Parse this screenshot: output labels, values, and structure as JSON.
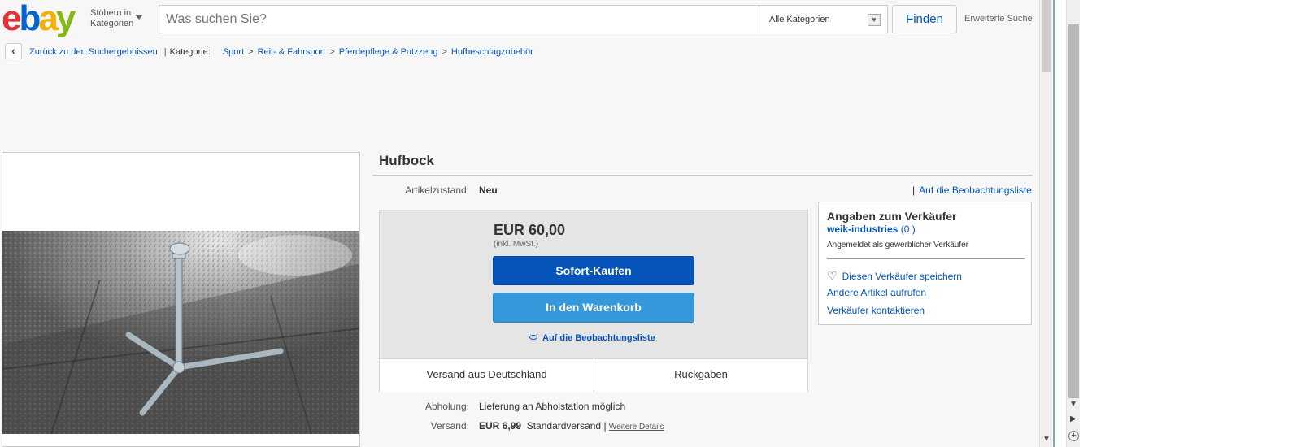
{
  "header": {
    "logo": {
      "e": "e",
      "b": "b",
      "a": "a",
      "y": "y"
    },
    "browse_line1": "Stöbern in",
    "browse_line2": "Kategorien",
    "search_placeholder": "Was suchen Sie?",
    "category_select": "Alle Kategorien",
    "find_label": "Finden",
    "advanced_label": "Erweiterte Suche"
  },
  "breadcrumb": {
    "back_label": "Zurück zu den Suchergebnissen",
    "category_prefix": "Kategorie:",
    "items": [
      "Sport",
      "Reit- & Fahrsport",
      "Pferdepflege & Putzzeug",
      "Hufbeschlagzubehör"
    ],
    "separator": ">"
  },
  "item": {
    "title": "Hufbock",
    "condition_label": "Artikelzustand:",
    "condition_value": "Neu",
    "watch_top": "Auf die Beobachtungsliste",
    "price": "EUR 60,00",
    "vat_note": "(inkl. MwSt.)",
    "buy_now": "Sofort-Kaufen",
    "add_to_cart": "In den Warenkorb",
    "watch_link": "Auf die Beobachtungsliste",
    "tab_shipping": "Versand aus Deutschland",
    "tab_returns": "Rückgaben",
    "pickup_label": "Abholung:",
    "pickup_value": "Lieferung an Abholstation möglich",
    "shipping_label": "Versand:",
    "shipping_price": "EUR 6,99",
    "shipping_method": "Standardversand",
    "shipping_more": "Weitere Details"
  },
  "seller": {
    "heading": "Angaben zum Verkäufer",
    "name": "weik-industries",
    "rating": "(0 )",
    "type": "Angemeldet als gewerblicher Verkäufer",
    "save": "Diesen Verkäufer speichern",
    "other_items": "Andere Artikel aufrufen",
    "contact": "Verkäufer kontaktieren"
  },
  "colors": {
    "ebay_red": "#e53238",
    "ebay_blue": "#0064d2",
    "ebay_yellow": "#f5af02",
    "ebay_green": "#86b817",
    "link_blue": "#0654ba",
    "buy_button": "#0654ba",
    "cart_button": "#3498db"
  }
}
